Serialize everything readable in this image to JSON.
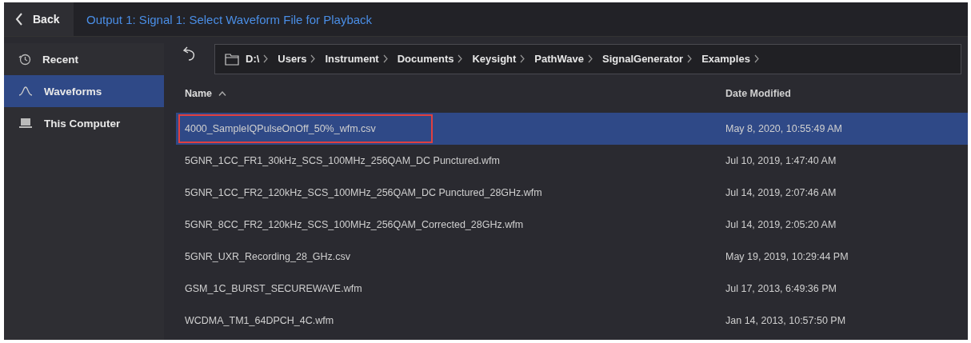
{
  "header": {
    "back_label": "Back",
    "title": "Output 1: Signal 1: Select Waveform File for Playback"
  },
  "sidebar": {
    "items": [
      {
        "label": "Recent",
        "kind": "recent",
        "selected": false
      },
      {
        "label": "Waveforms",
        "kind": "waveform",
        "selected": true
      },
      {
        "label": "This Computer",
        "kind": "computer",
        "selected": false
      }
    ]
  },
  "breadcrumb": [
    "D:\\",
    "Users",
    "Instrument",
    "Documents",
    "Keysight",
    "PathWave",
    "SignalGenerator",
    "Examples"
  ],
  "table": {
    "columns": [
      {
        "label": "Name",
        "sorted": true
      },
      {
        "label": "Date Modified",
        "sorted": false
      }
    ],
    "rows": [
      {
        "name": "4000_SampleIQPulseOnOff_50%_wfm.csv",
        "date": "May 8, 2020, 10:55:49 AM",
        "selected": true,
        "outlined": true
      },
      {
        "name": "5GNR_1CC_FR1_30kHz_SCS_100MHz_256QAM_DC Punctured.wfm",
        "date": "Jul 10, 2019, 1:47:40 AM",
        "selected": false,
        "outlined": false
      },
      {
        "name": "5GNR_1CC_FR2_120kHz_SCS_100MHz_256QAM_DC Punctured_28GHz.wfm",
        "date": "Jul 14, 2019, 2:07:46 AM",
        "selected": false,
        "outlined": false
      },
      {
        "name": "5GNR_8CC_FR2_120kHz_SCS_100MHz_256QAM_Corrected_28GHz.wfm",
        "date": "Jul 14, 2019, 2:05:20 AM",
        "selected": false,
        "outlined": false
      },
      {
        "name": "5GNR_UXR_Recording_28_GHz.csv",
        "date": "May 19, 2019, 10:29:44 PM",
        "selected": false,
        "outlined": false
      },
      {
        "name": "GSM_1C_BURST_SECUREWAVE.wfm",
        "date": "Jul 17, 2013, 6:49:36 PM",
        "selected": false,
        "outlined": false
      },
      {
        "name": "WCDMA_TM1_64DPCH_4C.wfm",
        "date": "Jan 14, 2013, 10:57:50 PM",
        "selected": false,
        "outlined": false
      }
    ]
  }
}
